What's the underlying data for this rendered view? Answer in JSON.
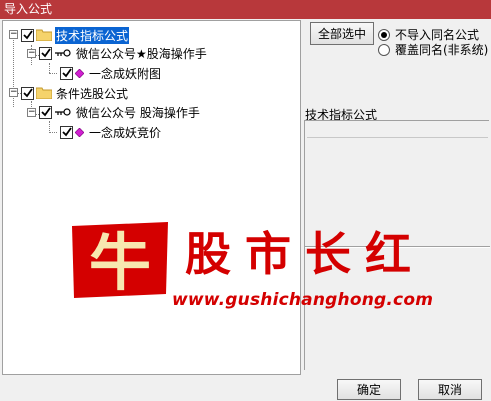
{
  "window": {
    "title": "导入公式"
  },
  "tree": {
    "nodes": [
      {
        "label": "技术指标公式",
        "checked": true,
        "selected": true,
        "icon": "folder-icon"
      },
      {
        "label": "微信公众号★股海操作手",
        "checked": true,
        "icon": "key-icon"
      },
      {
        "label": "一念成妖附图",
        "checked": true,
        "icon": "diamond-icon"
      },
      {
        "label": "条件选股公式",
        "checked": true,
        "icon": "folder-icon"
      },
      {
        "label": "微信公众号 股海操作手",
        "checked": true,
        "icon": "key-icon"
      },
      {
        "label": "一念成妖竞价",
        "checked": true,
        "icon": "diamond-icon"
      }
    ]
  },
  "options": {
    "select_all_label": "全部选中",
    "radio_no_import": "不导入同名公式",
    "radio_overwrite": "覆盖同名(非系统)",
    "selected_radio": "不导入同名公式"
  },
  "detail": {
    "label": "技术指标公式"
  },
  "watermark": {
    "seal_char": "牛",
    "title": "股市长红",
    "url": "www.gushichanghong.com"
  },
  "footer": {
    "ok_label": "确定",
    "cancel_label": "取消"
  },
  "colors": {
    "titlebar": "#b8383b",
    "selection": "#0a64d2",
    "watermark": "#d40000"
  }
}
